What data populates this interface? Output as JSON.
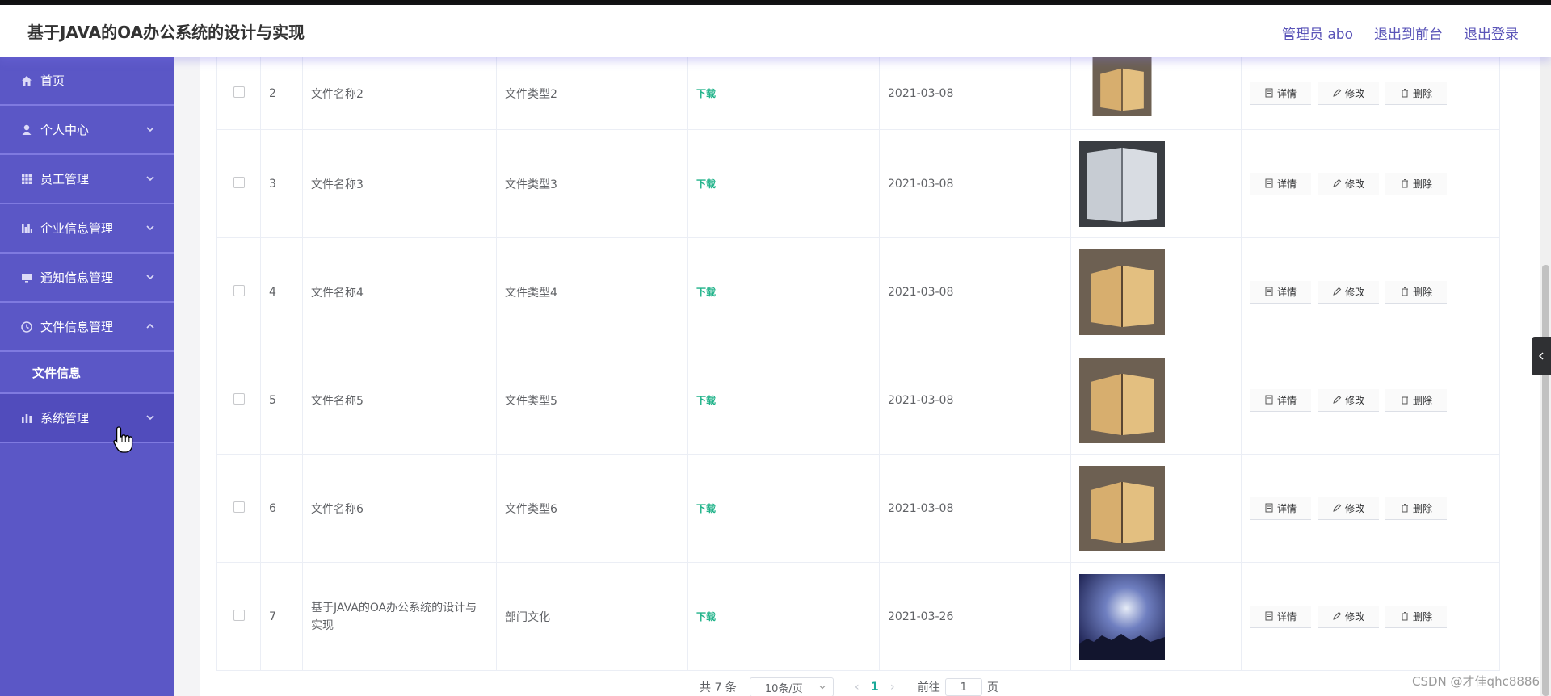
{
  "header": {
    "title": "基于JAVA的OA办公系统的设计与实现",
    "admin": "管理员 abo",
    "exit_front": "退出到前台",
    "logout": "退出登录"
  },
  "sidebar": {
    "items": [
      {
        "label": "首页",
        "icon": "home-icon"
      },
      {
        "label": "个人中心",
        "icon": "user-icon"
      },
      {
        "label": "员工管理",
        "icon": "grid-icon"
      },
      {
        "label": "企业信息管理",
        "icon": "bar-chart-icon"
      },
      {
        "label": "通知信息管理",
        "icon": "monitor-icon"
      },
      {
        "label": "文件信息管理",
        "icon": "clock-icon"
      },
      {
        "label": "系统管理",
        "icon": "chart-icon"
      }
    ],
    "submenu_label": "文件信息"
  },
  "table": {
    "rows": [
      {
        "index": "2",
        "name": "文件名称2",
        "type": "文件类型2",
        "download": "下载",
        "date": "2021-03-08",
        "thumb": "book-photo"
      },
      {
        "index": "3",
        "name": "文件名称3",
        "type": "文件类型3",
        "download": "下载",
        "date": "2021-03-08",
        "thumb": "book-photo-white"
      },
      {
        "index": "4",
        "name": "文件名称4",
        "type": "文件类型4",
        "download": "下载",
        "date": "2021-03-08",
        "thumb": "book-photo"
      },
      {
        "index": "5",
        "name": "文件名称5",
        "type": "文件类型5",
        "download": "下载",
        "date": "2021-03-08",
        "thumb": "book-photo"
      },
      {
        "index": "6",
        "name": "文件名称6",
        "type": "文件类型6",
        "download": "下载",
        "date": "2021-03-08",
        "thumb": "book-photo"
      },
      {
        "index": "7",
        "name": "基于JAVA的OA办公系统的设计与实现",
        "type": "部门文化",
        "download": "下载",
        "date": "2021-03-26",
        "thumb": "night-sky-photo"
      }
    ],
    "actions": {
      "detail": "详情",
      "edit": "修改",
      "delete": "删除"
    }
  },
  "pagination": {
    "total": "共 7 条",
    "page_size": "10条/页",
    "current": "1",
    "goto_prefix": "前往",
    "goto_value": "1",
    "goto_suffix": "页"
  },
  "watermark": "CSDN @才佳qhc8886",
  "colors": {
    "sidebar": "#5b57c6",
    "sidebar_divider": "#7f7ae0",
    "header_link": "#5a54b8",
    "download": "#21b38a",
    "page_active": "#19a998"
  }
}
